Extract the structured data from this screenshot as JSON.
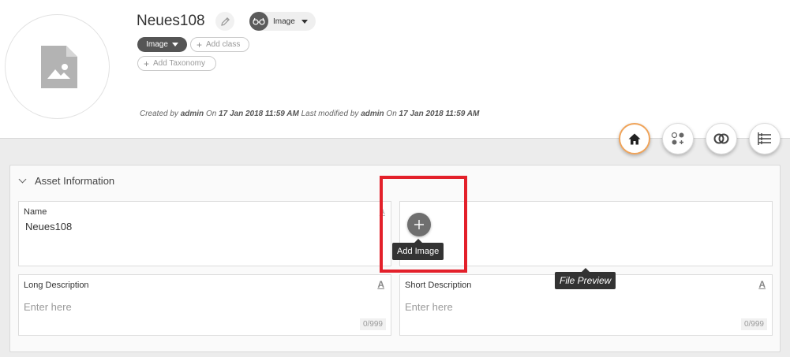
{
  "header": {
    "asset_title": "Neues108",
    "type_selector": {
      "label": "Image"
    },
    "class_chip": "Image",
    "add_class": "Add class",
    "add_taxonomy": "Add Taxonomy",
    "meta": {
      "created_by_label": "Created by",
      "created_by": "admin",
      "created_on_label": "On",
      "created_on": "17 Jan 2018 11:59 AM",
      "modified_by_label": "Last modified by",
      "modified_by": "admin",
      "modified_on_label": "On",
      "modified_on": "17 Jan 2018 11:59 AM"
    }
  },
  "toolbar": {
    "icons": [
      "home-icon",
      "apps-icon",
      "links-icon",
      "tree-icon"
    ],
    "active_color": "#f0a45a"
  },
  "panel": {
    "title": "Asset Information",
    "name_field": {
      "label": "Name",
      "value": "Neues108",
      "lang_marker": "A"
    },
    "add_image_tooltip": "Add Image",
    "file_preview_tooltip": "File Preview",
    "long_description": {
      "label": "Long Description",
      "placeholder": "Enter here",
      "counter": "0/999",
      "lang_marker": "A"
    },
    "short_description": {
      "label": "Short Description",
      "placeholder": "Enter here",
      "counter": "0/999",
      "lang_marker": "A"
    }
  },
  "highlight_color": "#e3202a"
}
